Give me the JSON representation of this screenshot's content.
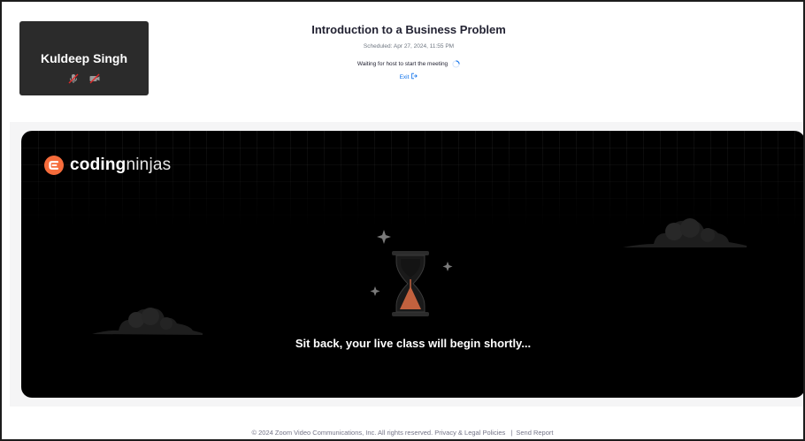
{
  "participant": {
    "name": "Kuldeep Singh",
    "mic_icon": "mic-muted-icon",
    "video_icon": "video-off-icon"
  },
  "meeting": {
    "title": "Introduction to a Business Problem",
    "scheduled": "Scheduled: Apr 27, 2024, 11:55 PM",
    "waiting_text": "Waiting for host to start the meeting",
    "exit_label": "Exit"
  },
  "banner": {
    "logo_bold": "coding",
    "logo_light": "ninjas",
    "tagline": "Sit back, your live class will begin shortly..."
  },
  "footer": {
    "copyright": "© 2024 Zoom Video Communications, Inc. All rights reserved.",
    "privacy_link": "Privacy & Legal Policies",
    "separator": "|",
    "report_link": "Send Report"
  },
  "colors": {
    "brand_orange": "#f66c3b",
    "zoom_blue": "#0e71eb",
    "tile_bg": "#2b2b2b",
    "hourglass_sand": "#c2613e"
  }
}
